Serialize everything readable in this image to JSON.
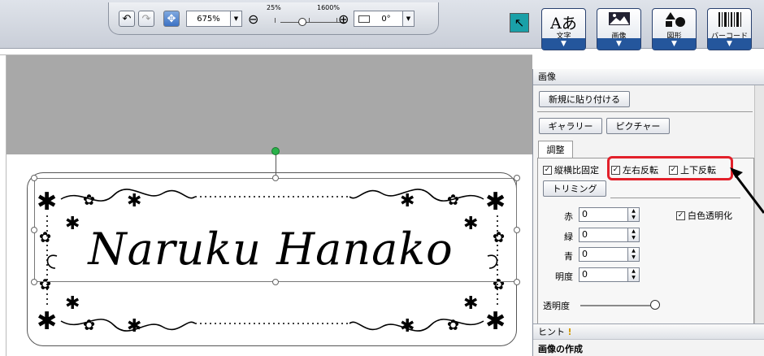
{
  "toolbar": {
    "zoom_value": "675%",
    "zoom_min_label": "25%",
    "zoom_max_label": "1600%",
    "rotation_value": "0°",
    "tools": [
      {
        "icon": "Aあ",
        "label": "文字"
      },
      {
        "icon": "画像-icon",
        "label": "画像"
      },
      {
        "icon": "図形-icon",
        "label": "図形"
      },
      {
        "icon": "barcode-icon",
        "label": "バーコード"
      }
    ],
    "dropdown_arrow": "▼"
  },
  "canvas": {
    "label_text": "Naruku Hanako"
  },
  "panel": {
    "header": "画像",
    "paste_new_button": "新規に貼り付ける",
    "gallery_button": "ギャラリー",
    "picture_button": "ピクチャー",
    "adjust_tab": "調整",
    "keep_aspect": {
      "label": "縦横比固定",
      "checked": true
    },
    "flip_horizontal": {
      "label": "左右反転",
      "checked": true
    },
    "flip_vertical": {
      "label": "上下反転",
      "checked": true
    },
    "trimming_button": "トリミング",
    "red_label": "赤",
    "red_value": "0",
    "green_label": "緑",
    "green_value": "0",
    "blue_label": "青",
    "blue_value": "0",
    "brightness_label": "明度",
    "brightness_value": "0",
    "white_transparent": {
      "label": "白色透明化",
      "checked": true
    },
    "transparency_label": "透明度",
    "hint_label": "ヒント",
    "hint_title": "画像の作成"
  },
  "colors": {
    "accent": "#24569c",
    "highlight": "#e2202a",
    "rotation_handle": "#2ab24a"
  }
}
